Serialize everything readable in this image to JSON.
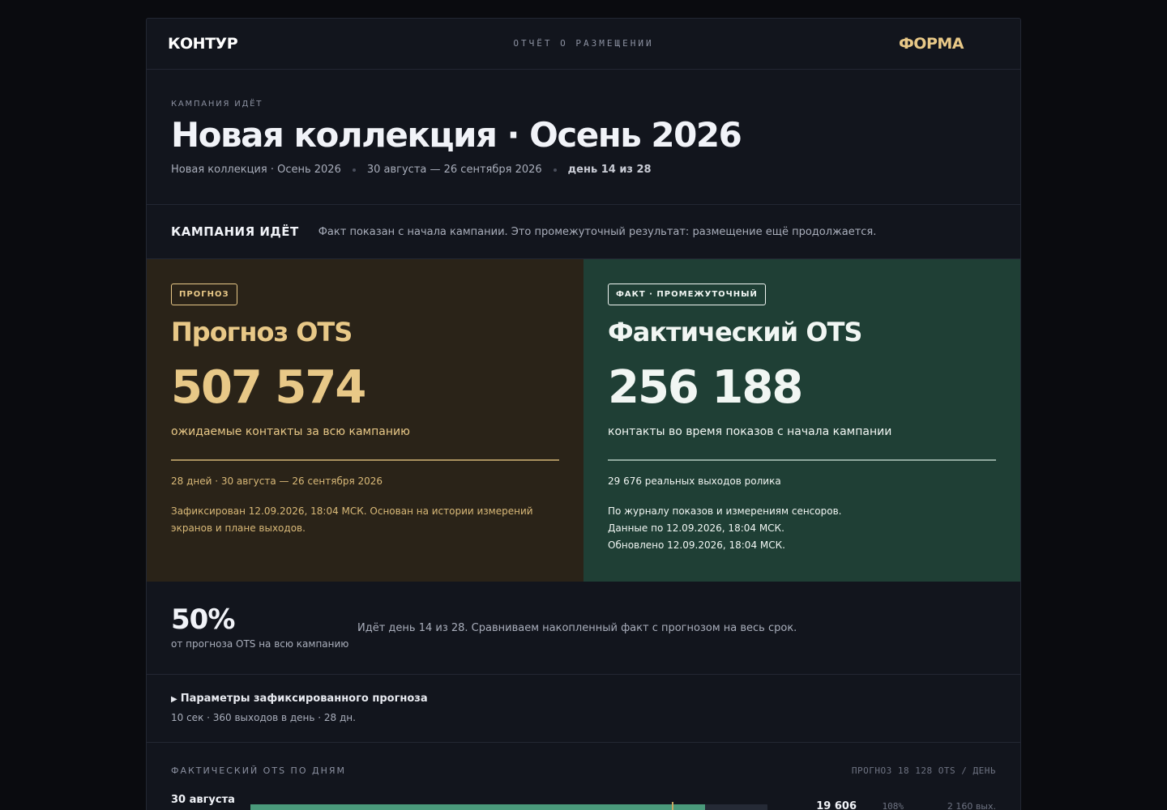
{
  "header": {
    "brand_left": "КОНТУР",
    "doc_title": "ОТЧЁТ О РАЗМЕЩЕНИИ",
    "brand_right": "ФОРМА"
  },
  "hero": {
    "eyebrow": "КАМПАНИЯ ИДЁТ",
    "title": "Новая коллекция · Осень 2026",
    "meta_name": "Новая коллекция · Осень 2026",
    "meta_dates": "30 августа — 26 сентября 2026",
    "meta_day": "день 14 из 28"
  },
  "status": {
    "title": "КАМПАНИЯ ИДЁТ",
    "text": "Факт показан с начала кампании. Это промежуточный результат: размещение ещё продолжается."
  },
  "forecast": {
    "badge": "ПРОГНОЗ",
    "title": "Прогноз OTS",
    "value": "507 574",
    "desc": "ожидаемые контакты за всю кампанию",
    "sub": "28 дней · 30 августа — 26 сентября 2026",
    "note": "Зафиксирован 12.09.2026, 18:04 МСК. Основан на истории измерений экранов и плане выходов."
  },
  "fact": {
    "badge": "ФАКТ · ПРОМЕЖУТОЧНЫЙ",
    "title": "Фактический OTS",
    "value": "256 188",
    "desc": "контакты во время показов с начала кампании",
    "sub": "29 676 реальных выходов ролика",
    "note_1": "По журналу показов и измерениям сенсоров.",
    "note_2": "Данные по 12.09.2026, 18:04 МСК.",
    "note_3": "Обновлено 12.09.2026, 18:04 МСК."
  },
  "progress": {
    "percent": "50%",
    "percent_label": "от прогноза OTS на всю кампанию",
    "text": "Идёт день 14 из 28. Сравниваем накопленный факт с прогнозом на весь срок."
  },
  "params": {
    "summary": "Параметры зафиксированного прогноза",
    "detail": "10 сек · 360 выходов в день · 28 дн."
  },
  "daily": {
    "title": "ФАКТИЧЕСКИЙ OTS ПО ДНЯМ",
    "note": "ПРОГНОЗ 18 128 OTS / ДЕНЬ",
    "rows": [
      {
        "date": "30 августа",
        "value": "19 606",
        "pct": "108%",
        "plays": "2 160 вых.",
        "fill_fraction": 0.88,
        "forecast_fraction": 0.815
      }
    ]
  },
  "colors": {
    "forecast_accent": "#e8c887",
    "forecast_bg": "#2a2318",
    "fact_bg": "#1f3f35",
    "fact_bar": "#4a9a7b",
    "page_bg": "#0a0b0f"
  }
}
